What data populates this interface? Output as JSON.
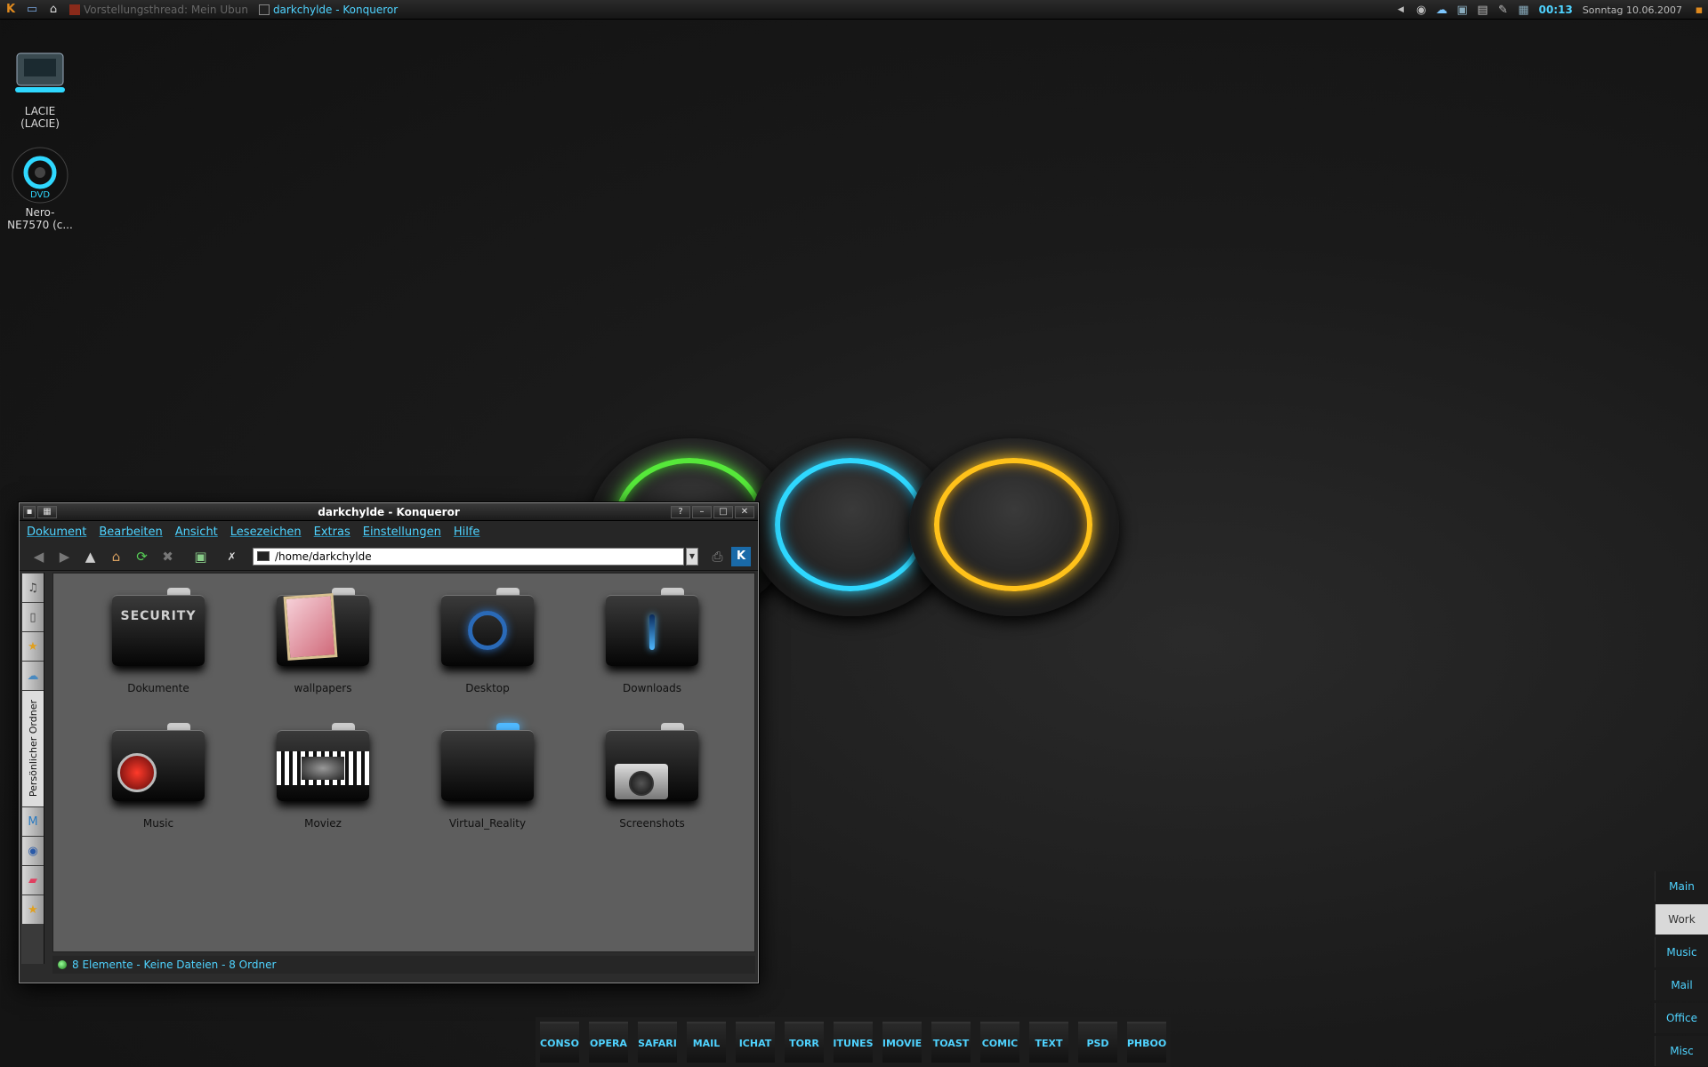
{
  "top_panel": {
    "launcher_icon": "k-menu-icon",
    "tasks": [
      {
        "label": "Vorstellungsthread: Mein Ubun",
        "active": false
      },
      {
        "label": "darkchylde - Konqueror",
        "active": true
      }
    ],
    "clock": "00:13",
    "date": "Sonntag 10.06.2007"
  },
  "desktop_icons": [
    {
      "label": "LACIE\n(LACIE)",
      "icon": "hard-drive-icon"
    },
    {
      "label": "Nero-\nNE7570 (c...",
      "icon": "dvd-icon"
    }
  ],
  "window": {
    "title": "darkchylde - Konqueror",
    "menu": [
      "Dokument",
      "Bearbeiten",
      "Ansicht",
      "Lesezeichen",
      "Extras",
      "Einstellungen",
      "Hilfe"
    ],
    "url": "/home/darkchylde",
    "sidebar_label": "Persönlicher Ordner",
    "folders": [
      {
        "label": "Dokumente",
        "glyph": "SECURITY"
      },
      {
        "label": "wallpapers",
        "glyph": ""
      },
      {
        "label": "Desktop",
        "glyph": ""
      },
      {
        "label": "Downloads",
        "glyph": ""
      },
      {
        "label": "Music",
        "glyph": ""
      },
      {
        "label": "Moviez",
        "glyph": ""
      },
      {
        "label": "Virtual_Reality",
        "glyph": ""
      },
      {
        "label": "Screenshots",
        "glyph": ""
      }
    ],
    "status": "8 Elemente - Keine Dateien - 8 Ordner"
  },
  "dock": [
    "CONSO",
    "OPERA",
    "SAFARI",
    "MAIL",
    "ICHAT",
    "TORR",
    "ITUNES",
    "IMOVIE",
    "TOAST",
    "COMIC",
    "TEXT",
    "PSD",
    "PHBOO"
  ],
  "pager": [
    "Main",
    "Work",
    "Music",
    "Mail",
    "Office",
    "Misc"
  ],
  "colors": {
    "accent": "#4fd3ff",
    "ring_green": "#56e83a",
    "ring_cyan": "#2fd8ff",
    "ring_yellow": "#ffc21a"
  }
}
